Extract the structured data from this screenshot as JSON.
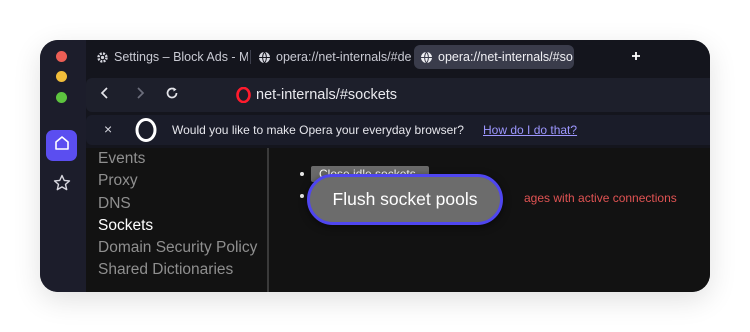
{
  "tabs": [
    {
      "label": "Settings – Block Ads - M",
      "icon": "gear-icon",
      "active": false
    },
    {
      "label": "opera://net-internals/#de",
      "icon": "globe-icon",
      "active": false
    },
    {
      "label": "opera://net-internals/#so",
      "icon": "globe-icon",
      "active": true
    }
  ],
  "address_bar": {
    "url": "net-internals/#sockets"
  },
  "infobar": {
    "close_symbol": "×",
    "message": "Would you like to make Opera your everyday browser?",
    "link": "How do I do that?"
  },
  "nav": {
    "items": [
      "Events",
      "Proxy",
      "DNS",
      "Sockets",
      "Domain Security Policy",
      "Shared Dictionaries"
    ],
    "selected": "Sockets"
  },
  "main": {
    "close_idle_label": "Close idle sockets",
    "flush_label": "Flush socket pools",
    "flush_note": "ages with active connections"
  },
  "colors": {
    "accent": "#5b4ef0",
    "highlight_border": "#4f46f0",
    "warning_text": "#e05353"
  }
}
